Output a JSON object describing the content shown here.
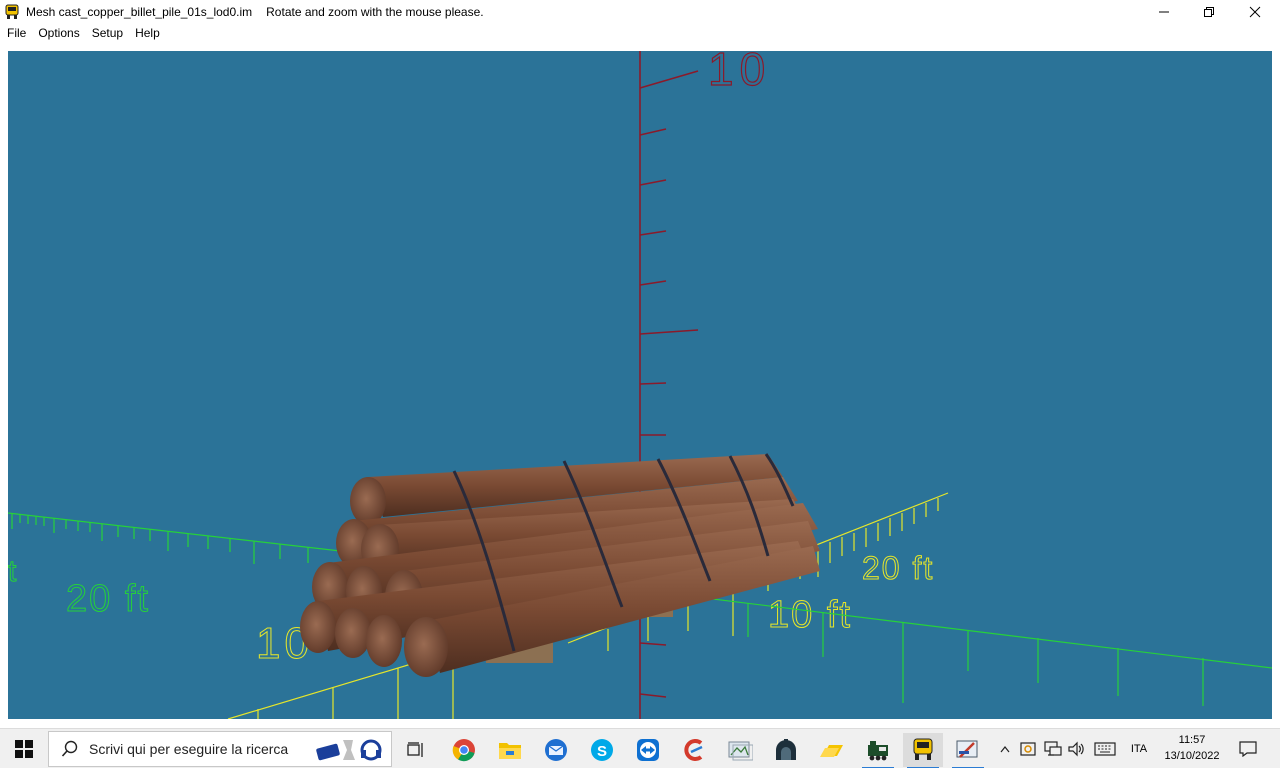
{
  "window": {
    "title": "Mesh cast_copper_billet_pile_01s_lod0.im",
    "hint": "Rotate and zoom with the mouse please.",
    "minimize_glyph": "—",
    "maximize_glyph": "❐",
    "close_glyph": "✕"
  },
  "menu": [
    "File",
    "Options",
    "Setup",
    "Help"
  ],
  "viewport": {
    "background": "#2b7398",
    "labels": {
      "vertical_axis": "10",
      "left_far": "20 ft",
      "left_near": "10",
      "left_edge": "t",
      "right_far": "20 ft",
      "right_near": "10 ft"
    },
    "colors": {
      "vertical_axis": "#8b1a2a",
      "green_grid": "#26d13a",
      "yellow_grid": "#e6e62a",
      "copper": "#7a4a33"
    }
  },
  "taskbar": {
    "search_placeholder": "Scrivi qui per eseguire la ricerca",
    "icons": [
      "task-view-icon",
      "chrome-icon",
      "file-explorer-icon",
      "thunderbird-icon",
      "skype-icon",
      "teamviewer-icon",
      "ccleaner-icon",
      "photo-viewer-icon",
      "station-icon",
      "folder-yellow-icon",
      "train-icon",
      "mesh-viewer-icon",
      "editor-icon"
    ],
    "tray": {
      "language": "ITA",
      "time": "11:57",
      "date": "13/10/2022"
    }
  }
}
